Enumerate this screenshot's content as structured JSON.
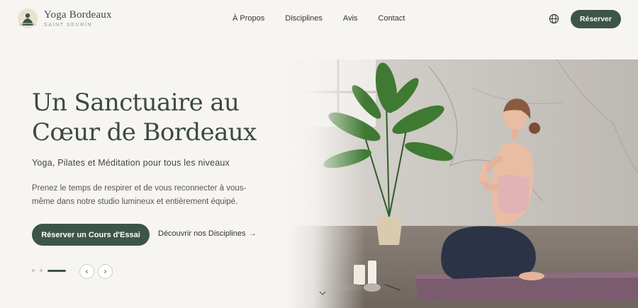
{
  "brand": {
    "name": "Yoga Bordeaux",
    "tagline": "SAINT SEURIN"
  },
  "nav": {
    "items": [
      {
        "label": "À Propos"
      },
      {
        "label": "Disciplines"
      },
      {
        "label": "Avis"
      },
      {
        "label": "Contact"
      }
    ],
    "cta_label": "Réserver"
  },
  "hero": {
    "title_line1": "Un Sanctuaire au",
    "title_line2": "Cœur de Bordeaux",
    "subtitle": "Yoga, Pilates et Méditation pour tous les niveaux",
    "description": "Prenez le temps de respirer et de vous reconnecter à vous-même dans notre studio lumineux et entièrement équipé.",
    "primary_cta": "Réserver un Cours d'Essai",
    "secondary_cta": "Découvrir nos Disciplines",
    "secondary_cta_arrow": "→"
  },
  "slider": {
    "slide_count": 3,
    "active_index": 2,
    "prev_symbol": "‹",
    "next_symbol": "›"
  },
  "icons": {
    "language": "globe-icon",
    "scroll": "chevron-down-icon",
    "logo": "meditation-figure-icon"
  },
  "colors": {
    "accent": "#3d5548",
    "background": "#f7f5f2",
    "title": "#3d4a42"
  }
}
